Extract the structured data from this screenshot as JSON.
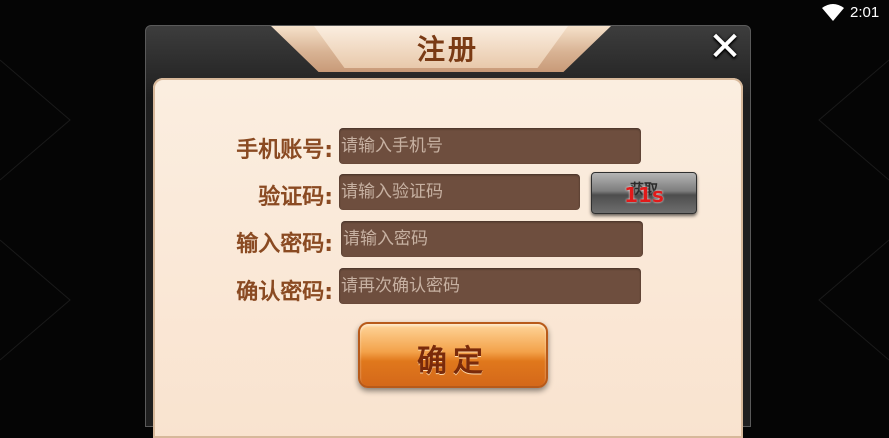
{
  "status_bar": {
    "time": "2:01",
    "icons": [
      "wifi-icon"
    ]
  },
  "dialog": {
    "title": "注册",
    "close_label": "✕",
    "fields": [
      {
        "label": "手机账号:",
        "placeholder": "请输入手机号"
      },
      {
        "label": "验证码:",
        "placeholder": "请输入验证码"
      },
      {
        "label": "输入密码:",
        "placeholder": "请输入密码"
      },
      {
        "label": "确认密码:",
        "placeholder": "请再次确认密码"
      }
    ],
    "get_code_button": {
      "label": "获取",
      "countdown": "11s"
    },
    "confirm_button": {
      "label": "确定"
    }
  },
  "colors": {
    "panel_bg": "#fbeee0",
    "label_text": "#8a4a22",
    "input_bg": "#6e4e3e",
    "confirm_orange": "#f3a24a",
    "countdown_red": "#e21a1a"
  }
}
